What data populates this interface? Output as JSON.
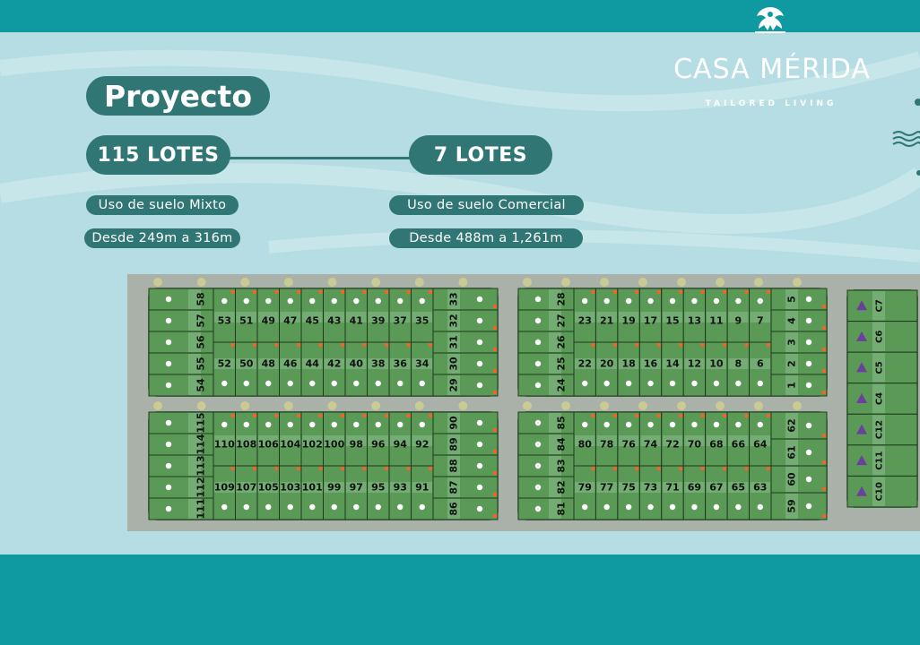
{
  "brand": {
    "name": "CASA MÉRIDA",
    "tagline": "TAILORED LIVING"
  },
  "project": {
    "title": "Proyecto",
    "mixed": {
      "lots": "115 LOTES",
      "use": "Uso de suelo Mixto",
      "range": "Desde 249m a 316m"
    },
    "commercial": {
      "lots": "7 LOTES",
      "use": "Uso de suelo Comercial",
      "range": "Desde 488m a 1,261m"
    }
  },
  "colors": {
    "teal": "#0e9aa0",
    "pill": "#2f7675",
    "lot": "#5a9a56",
    "road": "#a9b1a8",
    "commercial_marker": "#6a3f9e",
    "corner_marker": "#f0642a"
  },
  "map": {
    "block_a": {
      "left_column": [
        "58",
        "57",
        "56",
        "55",
        "54"
      ],
      "top_row": [
        "53",
        "51",
        "49",
        "47",
        "45",
        "43",
        "41",
        "39",
        "37",
        "35"
      ],
      "bottom_row": [
        "52",
        "50",
        "48",
        "46",
        "44",
        "42",
        "40",
        "38",
        "36",
        "34"
      ],
      "right_column": [
        "33",
        "32",
        "31",
        "30",
        "29"
      ]
    },
    "block_b": {
      "left_column": [
        "28",
        "27",
        "26",
        "25",
        "24"
      ],
      "top_row": [
        "23",
        "21",
        "19",
        "17",
        "15",
        "13",
        "11",
        "9",
        "7"
      ],
      "bottom_row": [
        "22",
        "20",
        "18",
        "16",
        "14",
        "12",
        "10",
        "8",
        "6"
      ],
      "right_column": [
        "5",
        "4",
        "3",
        "2",
        "1"
      ]
    },
    "block_c": {
      "left_column": [
        "115",
        "114",
        "113",
        "112",
        "111"
      ],
      "top_row": [
        "110",
        "108",
        "106",
        "104",
        "102",
        "100",
        "98",
        "96",
        "94",
        "92"
      ],
      "bottom_row": [
        "109",
        "107",
        "105",
        "103",
        "101",
        "99",
        "97",
        "95",
        "93",
        "91"
      ],
      "right_column": [
        "90",
        "89",
        "88",
        "87",
        "86"
      ]
    },
    "block_d": {
      "left_column": [
        "85",
        "84",
        "83",
        "82",
        "81"
      ],
      "top_row": [
        "80",
        "78",
        "76",
        "74",
        "72",
        "70",
        "68",
        "66",
        "64"
      ],
      "bottom_row": [
        "79",
        "77",
        "75",
        "73",
        "71",
        "69",
        "67",
        "65",
        "63"
      ],
      "right_column": [
        "62",
        "61",
        "60",
        "59"
      ]
    },
    "commercial": [
      "C7",
      "C6",
      "C5",
      "C4",
      "C12",
      "C11",
      "C10"
    ]
  }
}
